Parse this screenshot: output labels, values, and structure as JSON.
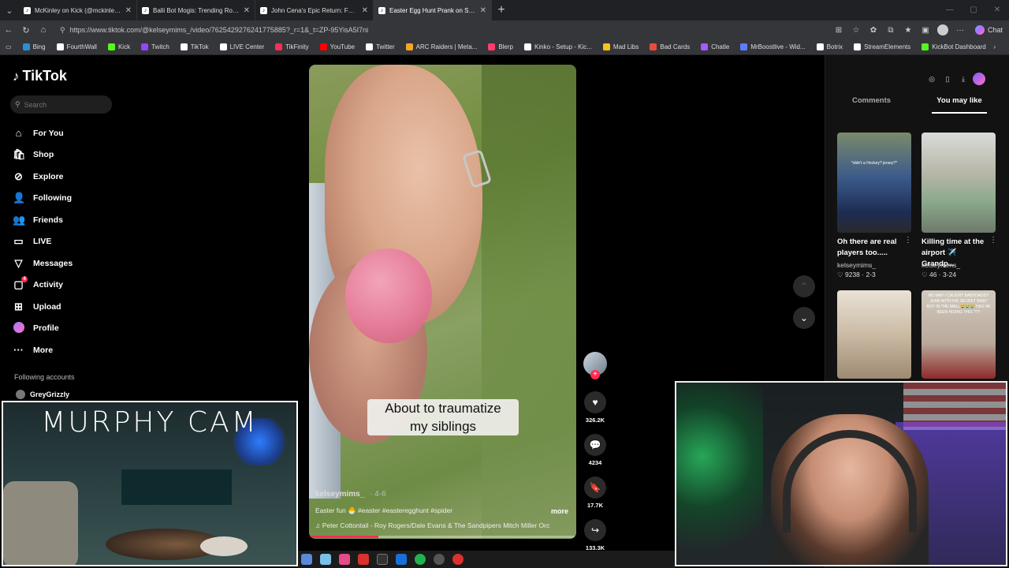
{
  "browser": {
    "tabs": [
      {
        "label": "McKinley on Kick (@mckinley.tv) |",
        "icon": "tiktok-icon",
        "active": false
      },
      {
        "label": "Balli Bot Mogis: Trending Robot &",
        "icon": "tiktok-icon",
        "active": false
      },
      {
        "label": "John Cena's Epic Return: F5 & Atti",
        "icon": "tiktok-icon",
        "active": false
      },
      {
        "label": "Easter Egg Hunt Prank on Siblings",
        "icon": "tiktok-icon",
        "active": true
      }
    ],
    "url": "https://www.tiktok.com/@kelseymims_/video/7625429276241775885?_r=1&_t=ZP-95YisA5I7ni",
    "chat_label": "Chat",
    "bookmarks": [
      {
        "label": "Bing",
        "color": "#2b8fd6"
      },
      {
        "label": "FourthWall",
        "color": "#ffffff"
      },
      {
        "label": "Kick",
        "color": "#53fc18"
      },
      {
        "label": "Twitch",
        "color": "#9146ff"
      },
      {
        "label": "TikTok",
        "color": "#ffffff"
      },
      {
        "label": "LIVE Center",
        "color": "#ffffff"
      },
      {
        "label": "TikFinity",
        "color": "#ff2c55"
      },
      {
        "label": "YouTube",
        "color": "#ff0000"
      },
      {
        "label": "Twitter",
        "color": "#ffffff"
      },
      {
        "label": "ARC Raiders | Meta...",
        "color": "#f5a623"
      },
      {
        "label": "Blerp",
        "color": "#ff3b6b"
      },
      {
        "label": "Kinko - Setup - Kic...",
        "color": "#ffffff"
      },
      {
        "label": "Mad Libs",
        "color": "#f5c518"
      },
      {
        "label": "Bad Cards",
        "color": "#e84d3d"
      },
      {
        "label": "Chatle",
        "color": "#a25cff"
      },
      {
        "label": "MrBoostlive - Wid...",
        "color": "#5c7cff"
      },
      {
        "label": "Botrix",
        "color": "#ffffff"
      },
      {
        "label": "StreamElements",
        "color": "#ffffff"
      },
      {
        "label": "KickBot Dashboard",
        "color": "#53fc18"
      }
    ]
  },
  "tiktok": {
    "brand": "TikTok",
    "search_placeholder": "Search",
    "nav": [
      {
        "label": "For You",
        "icon": "home-icon",
        "glyph": "⌂"
      },
      {
        "label": "Shop",
        "icon": "shop-icon",
        "glyph": "🛍"
      },
      {
        "label": "Explore",
        "icon": "compass-icon",
        "glyph": "⊘"
      },
      {
        "label": "Following",
        "icon": "following-icon",
        "glyph": "👤"
      },
      {
        "label": "Friends",
        "icon": "friends-icon",
        "glyph": "👥"
      },
      {
        "label": "LIVE",
        "icon": "live-icon",
        "glyph": "▭"
      },
      {
        "label": "Messages",
        "icon": "messages-icon",
        "glyph": "▽"
      },
      {
        "label": "Activity",
        "icon": "activity-icon",
        "glyph": "▢",
        "badge": "4"
      },
      {
        "label": "Upload",
        "icon": "upload-icon",
        "glyph": "⊞"
      },
      {
        "label": "Profile",
        "icon": "profile-icon",
        "glyph": ""
      },
      {
        "label": "More",
        "icon": "more-icon",
        "glyph": "···"
      }
    ],
    "following_accounts_title": "Following accounts",
    "following_accounts": [
      {
        "name": "GreyGrizzly"
      }
    ]
  },
  "video": {
    "caption_line1": "About to traumatize",
    "caption_line2": "my siblings",
    "username": "kelseymims_",
    "date": "4-6",
    "description": "Easter fun 🐣 #easter #easteregghunt #spider",
    "more": "more",
    "music": "Peter Cottontail - Roy Rogers/Dale Evans & The Sandpipers Mitch Miller Orc",
    "progress": 0.26,
    "likes": "326.2K",
    "comments": "4234",
    "saves": "17.7K",
    "shares": "133.3K"
  },
  "right_panel": {
    "tabs": [
      "Comments",
      "You may like"
    ],
    "active_tab": 1,
    "cards": [
      {
        "title": "Oh there are real players too.....",
        "user": "kelseymims_",
        "likes": "9238",
        "date": "2-3",
        "thumb_text": "*didn't a Hockey? jersey?*"
      },
      {
        "title": "Killing time at the airport ✈️ Grandp...",
        "user": "kelseymims_",
        "likes": "46",
        "date": "3-24",
        "thumb_text": ""
      },
      {
        "title": "",
        "user": "",
        "likes": "",
        "date": "",
        "thumb_text": ""
      },
      {
        "title": "",
        "user": "",
        "likes": "",
        "date": "",
        "thumb_text": "NO WAY I CAUGHT BABYDADDY JUAN WITH HIS SECRET BABY BOY IN THE MALL😭😭😭 HAS HE BEEN HIDING THIS ???"
      }
    ]
  },
  "overlays": {
    "murphy_cam_title": "MURPHY CAM"
  }
}
